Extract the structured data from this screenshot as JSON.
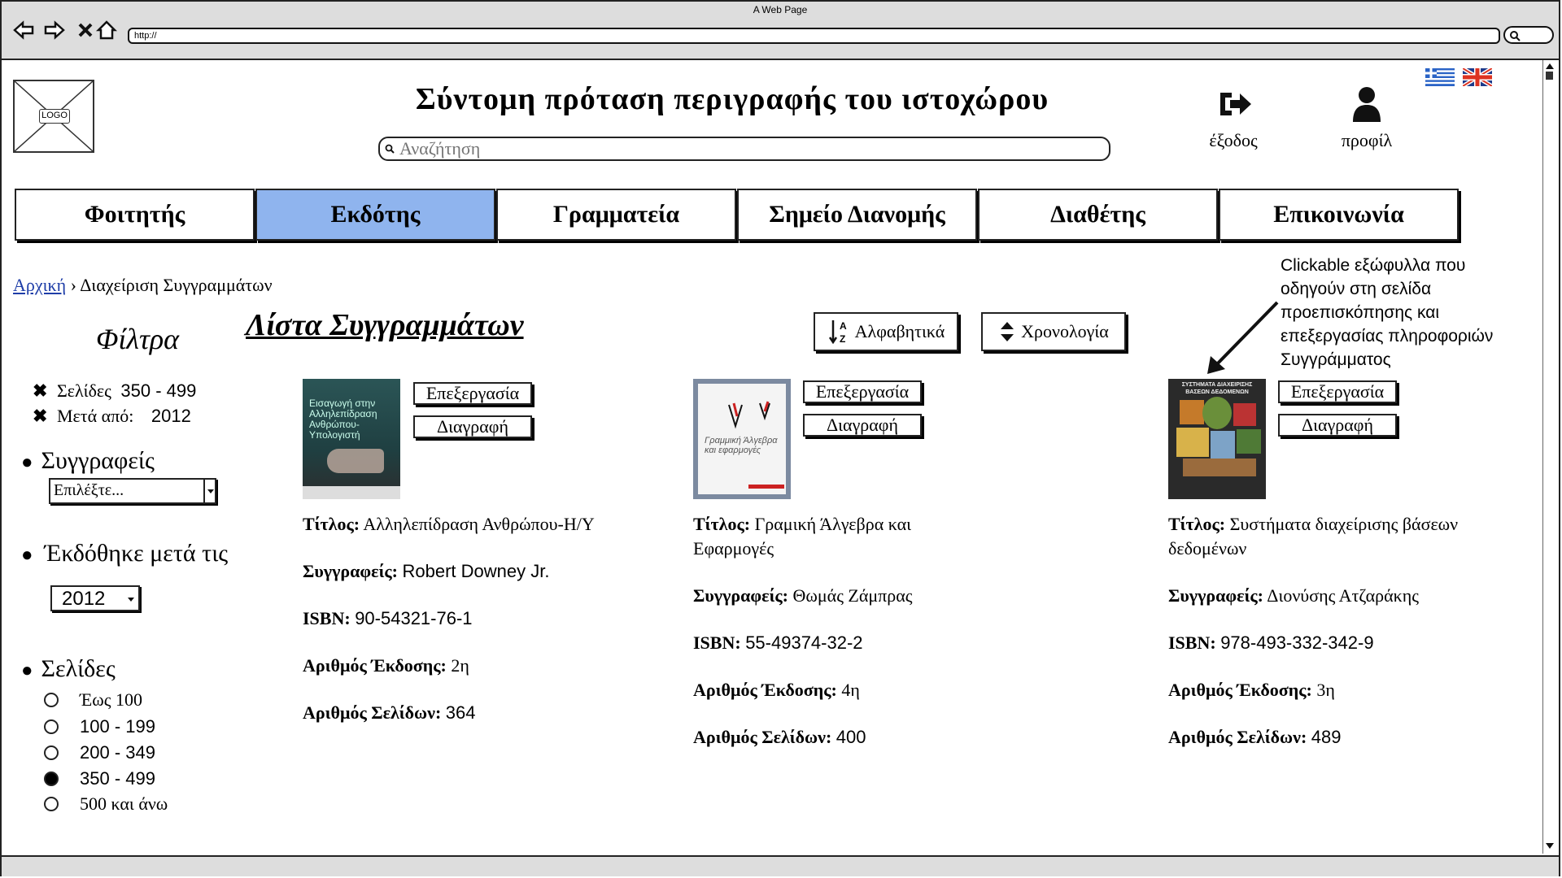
{
  "window": {
    "title": "A Web Page",
    "url": "http://"
  },
  "header": {
    "logo": "LOGO",
    "title": "Σύντομη πρόταση περιγραφής του ιστοχώρου",
    "search_placeholder": "Αναζήτηση",
    "logout_label": "έξοδος",
    "profile_label": "προφίλ"
  },
  "nav": {
    "tabs": [
      {
        "label": "Φοιτητής"
      },
      {
        "label": "Εκδότης",
        "active": true
      },
      {
        "label": "Γραμματεία"
      },
      {
        "label": "Σημείο Διανομής"
      },
      {
        "label": "Διαθέτης"
      },
      {
        "label": "Επικοινωνία"
      }
    ]
  },
  "breadcrumb": {
    "home": "Αρχική",
    "separator": "›",
    "current": "Διαχείριση Συγγραμμάτων"
  },
  "filters": {
    "title": "Φίλτρα",
    "active": [
      {
        "label": "Σελίδες",
        "value": "350 - 499"
      },
      {
        "label": "Μετά από:",
        "value": "2012"
      }
    ],
    "authors_title": "Συγγραφείς",
    "authors_select": "Επιλέξτε...",
    "published_title": "Έκδόθηκε μετά τις",
    "year_select": "2012",
    "pages_title": "Σελίδες",
    "pages_options": [
      {
        "label": "Έως 100",
        "selected": false
      },
      {
        "label": "100 - 199",
        "selected": false
      },
      {
        "label": "200 - 349",
        "selected": false
      },
      {
        "label": "350 - 499",
        "selected": true
      },
      {
        "label": "500 και άνω",
        "selected": false
      }
    ]
  },
  "list": {
    "title": "Λίστα Συγγραμμάτων",
    "sort_alpha": "Αλφαβητικά",
    "sort_chrono": "Χρονολογία",
    "edit_label": "Επεξεργασία",
    "delete_label": "Διαγραφή",
    "field_labels": {
      "title": "Τίτλος:",
      "authors": "Συγγραφείς:",
      "isbn": "ISBN:",
      "edition": "Αριθμός Έκδοσης:",
      "pages": "Αριθμός Σελίδων:"
    },
    "books": [
      {
        "cover_title": "Εισαγωγή στην Αλληλεπίδραση Ανθρώπου-Υπολογιστή",
        "title": "Αλληλεπίδραση Ανθρώπου-Η/Υ",
        "authors": "Robert Downey Jr.",
        "isbn": "90-54321-76-1",
        "edition": "2η",
        "pages": "364"
      },
      {
        "cover_title": "Γραμμική Άλγεβρα και εφαρμογές",
        "title": "Γραμική Άλγεβρα και Εφαρμογές",
        "authors": "Θωμάς Ζάμπρας",
        "isbn": "55-49374-32-2",
        "edition": "4η",
        "pages": "400"
      },
      {
        "cover_title": "ΣΥΣΤΗΜΑΤΑ ΔΙΑΧΕΙΡΙΣΗΣ ΒΑΣΕΩΝ ΔΕΔΟΜΕΝΩΝ",
        "title": "Συστήματα διαχείρισης βάσεων δεδομένων",
        "authors": "Διονύσης Ατζαράκης",
        "isbn": "978-493-332-342-9",
        "edition": "3η",
        "pages": "489"
      }
    ]
  },
  "annotation": {
    "text": "Clickable εξώφυλλα που οδηγούν στη σελίδα προεπισκόπησης και επεξεργασίας πληροφοριών Συγγράμματος"
  }
}
